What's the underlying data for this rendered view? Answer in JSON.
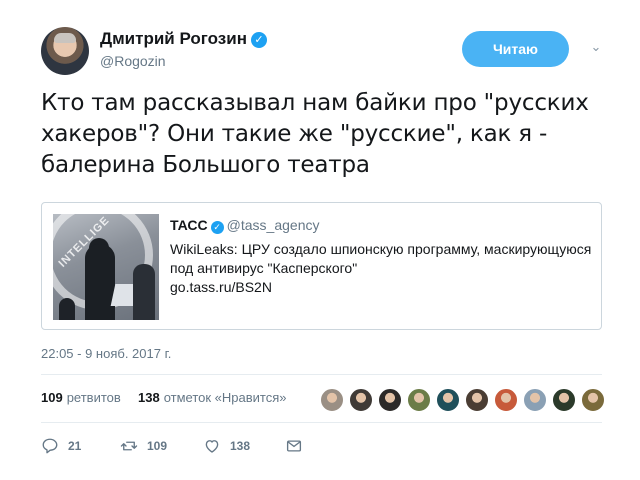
{
  "author": {
    "name": "Дмитрий Рогозин",
    "handle": "@Rogozin",
    "verified_glyph": "✓"
  },
  "follow_button": {
    "label": "Читаю"
  },
  "menu_caret": "⌄",
  "tweet": {
    "text": "Кто там рассказывал нам байки про \"русских хакеров\"? Они такие же \"русские\", как я - балерина Большого театра"
  },
  "quote": {
    "author_name": "ТАСС",
    "author_handle": "@tass_agency",
    "verified_glyph": "✓",
    "text_line1": "WikiLeaks: ЦРУ создало шпионскую программу, маскирующуюся",
    "text_line2": "под антивирус \"Касперского\"",
    "link": "go.tass.ru/BS2N",
    "image_overlay_text": "INTELLIGE"
  },
  "timestamp": "22:05 - 9 нояб. 2017 г.",
  "stats": {
    "retweets_count": "109",
    "retweets_label": "ретвитов",
    "likes_count": "138",
    "likes_label": "отметок «Нравится»"
  },
  "likers": [
    {
      "name": "liker-1",
      "color": "#9a8f84"
    },
    {
      "name": "liker-2",
      "color": "#3f3a36"
    },
    {
      "name": "liker-3",
      "color": "#2c2a29"
    },
    {
      "name": "liker-4",
      "color": "#6b7c47"
    },
    {
      "name": "liker-5",
      "color": "#1f4f5a"
    },
    {
      "name": "liker-6",
      "color": "#4a3d33"
    },
    {
      "name": "liker-7",
      "color": "#c75a3a"
    },
    {
      "name": "liker-8",
      "color": "#8aa0b4"
    },
    {
      "name": "liker-9",
      "color": "#2b3a2a"
    },
    {
      "name": "liker-10",
      "color": "#7a6a3b"
    }
  ],
  "actions": {
    "reply_count": "21",
    "retweet_count": "109",
    "like_count": "138"
  },
  "colors": {
    "accent": "#1da1f2",
    "button": "#4ab3f4",
    "muted": "#657786",
    "border": "#ccd6dd"
  }
}
